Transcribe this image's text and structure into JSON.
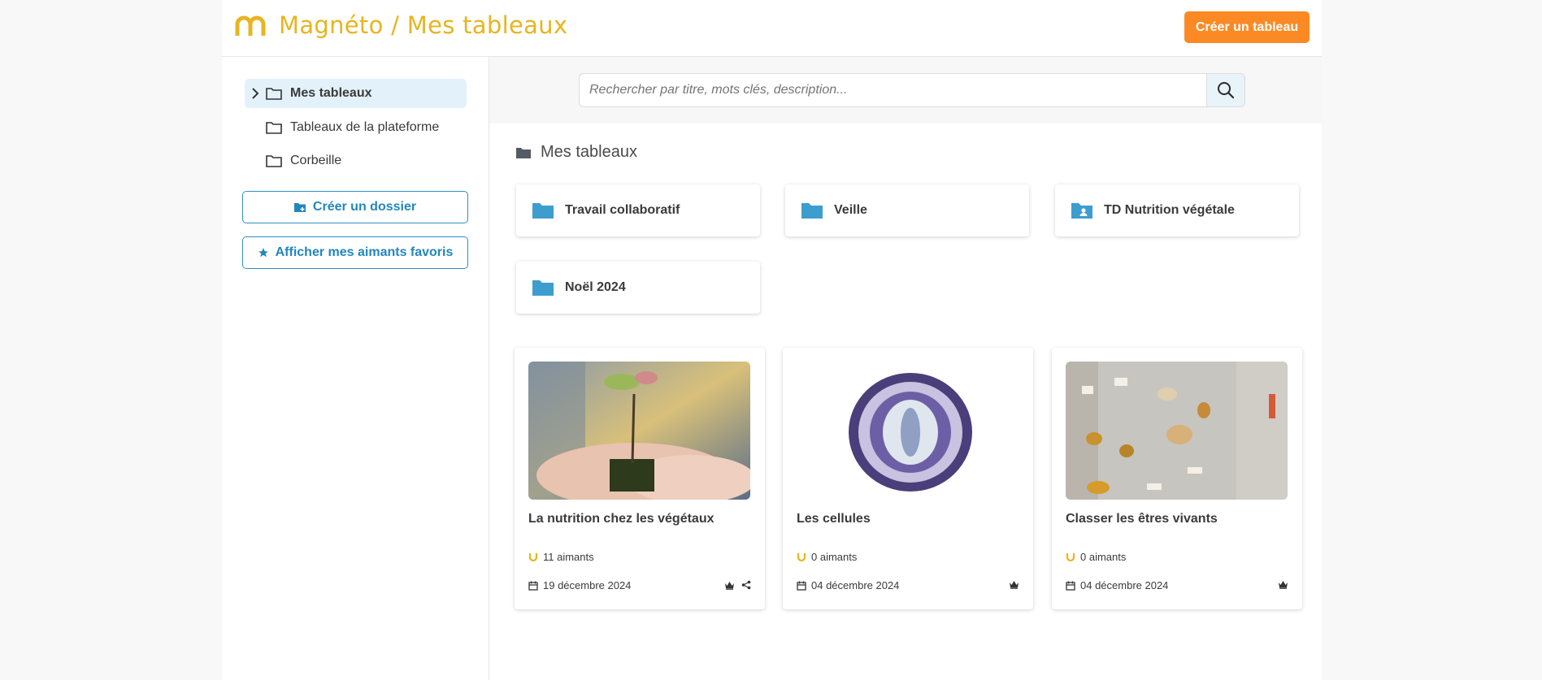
{
  "header": {
    "title": "Magnéto / Mes tableaux",
    "create_board_label": "Créer un tableau",
    "accent_color": "#e8b41f",
    "button_color": "#fb8a24"
  },
  "sidebar": {
    "items": [
      {
        "label": "Mes tableaux",
        "active": true,
        "icon": "folder-icon"
      },
      {
        "label": "Tableaux de la plateforme",
        "active": false,
        "icon": "folder-icon"
      },
      {
        "label": "Corbeille",
        "active": false,
        "icon": "folder-icon"
      }
    ],
    "create_folder_label": "Créer un dossier",
    "favorites_label": "Afficher mes aimants favoris"
  },
  "search": {
    "placeholder": "Rechercher par titre, mots clés, description..."
  },
  "section": {
    "title": "Mes tableaux"
  },
  "folders": [
    {
      "name": "Travail collaboratif",
      "icon": "folder-icon"
    },
    {
      "name": "Veille",
      "icon": "folder-icon"
    },
    {
      "name": "TD Nutrition végétale",
      "icon": "shared-folder-icon"
    },
    {
      "name": "Noël 2024",
      "icon": "folder-icon"
    }
  ],
  "boards": [
    {
      "title": "La nutrition chez les végétaux",
      "magnets": "11 aimants",
      "date": "19 décembre 2024",
      "owner": true,
      "shared": true
    },
    {
      "title": "Les cellules",
      "magnets": "0 aimants",
      "date": "04 décembre 2024",
      "owner": true,
      "shared": false
    },
    {
      "title": "Classer les êtres vivants",
      "magnets": "0 aimants",
      "date": "04 décembre 2024",
      "owner": true,
      "shared": false
    }
  ]
}
